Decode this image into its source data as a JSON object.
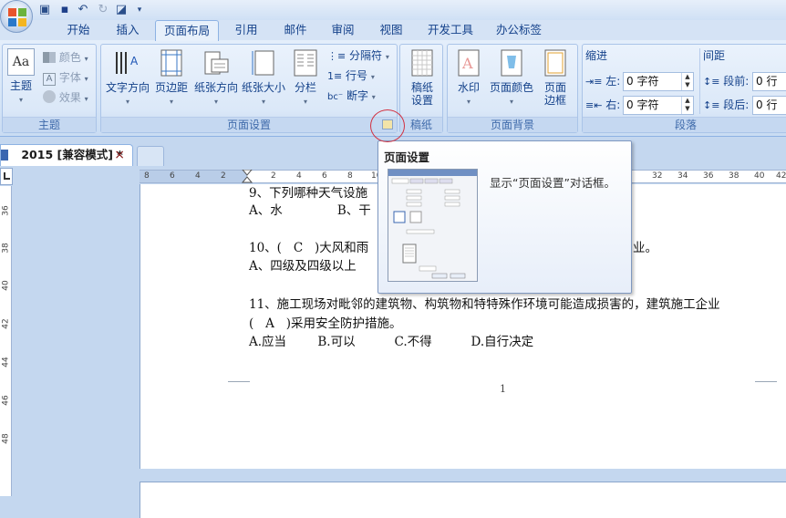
{
  "tabs": [
    {
      "label": "开始"
    },
    {
      "label": "插入"
    },
    {
      "label": "页面布局"
    },
    {
      "label": "引用"
    },
    {
      "label": "邮件"
    },
    {
      "label": "审阅"
    },
    {
      "label": "视图"
    },
    {
      "label": "开发工具"
    },
    {
      "label": "办公标签"
    }
  ],
  "ribbon": {
    "theme": {
      "label": "主题",
      "main": "主题",
      "colors": "颜色",
      "fonts": "字体",
      "effects": "效果"
    },
    "page_setup": {
      "label": "页面设置",
      "text_direction": "文字方向",
      "margins": "页边距",
      "orientation": "纸张方向",
      "size": "纸张大小",
      "columns": "分栏",
      "breaks": "分隔符",
      "line_numbers": "行号",
      "hyphenation": "断字"
    },
    "manuscript": {
      "label": "稿纸",
      "button_line1": "稿纸",
      "button_line2": "设置"
    },
    "page_background": {
      "label": "页面背景",
      "watermark": "水印",
      "page_color": "页面颜色",
      "borders_line1": "页面",
      "borders_line2": "边框"
    },
    "paragraph": {
      "label": "段落",
      "indent": "缩进",
      "left": "左:",
      "right": "右:",
      "left_value": "0 字符",
      "right_value": "0 字符",
      "spacing": "间距",
      "before": "段前:",
      "after": "段后:",
      "before_value": "0 行",
      "after_value": "0 行"
    }
  },
  "doc_tab": {
    "title": "2015 [兼容模式] *",
    "close": "×"
  },
  "ruler": {
    "left_ticks": [
      "8",
      "6",
      "4",
      "2"
    ],
    "right_ticks": [
      "2",
      "4",
      "6",
      "8",
      "10",
      "32",
      "34",
      "36",
      "38",
      "40",
      "42"
    ],
    "vertical_ticks": [
      "36",
      "38",
      "40",
      "42",
      "44",
      "46",
      "48"
    ]
  },
  "document": {
    "lines": [
      "9、下列哪种天气设施",
      "A、水              B、干",
      "10、(   C   )大风和雨",
      "业。",
      "A、四级及四级以上",
      "11、施工现场对毗邻的建筑物、构筑物和特特殊作环境可能造成损害的，建筑施工企业",
      "(   A   )采用安全防护措施。",
      "A.应当        B.可以          C.不得          D.自行决定"
    ],
    "page_number": "1"
  },
  "tooltip": {
    "title": "页面设置",
    "description": "显示“页面设置”对话框。"
  },
  "colors": {
    "accent": "#15428b",
    "annotation": "#d23040"
  }
}
